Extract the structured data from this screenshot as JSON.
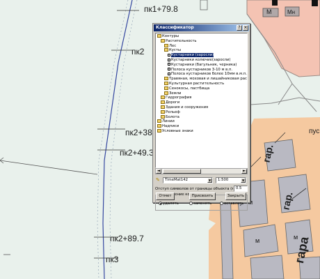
{
  "map": {
    "stations": [
      "пк1+79.8",
      "пк2",
      "пк2+38",
      "пк2+49.3",
      "пк2+89.7",
      "пк3"
    ],
    "building_labels": [
      "М",
      "Мн",
      "м",
      "м",
      "м"
    ],
    "street_labels": [
      "гар.",
      "гар.",
      "гара",
      "пус"
    ]
  },
  "dialog": {
    "title": "Классификатор",
    "tree": [
      {
        "label": "Контуры",
        "level": 0
      },
      {
        "label": "Растительность",
        "level": 1
      },
      {
        "label": "Лес",
        "level": 2
      },
      {
        "label": "Кусты",
        "level": 2
      },
      {
        "label": "Кустарники (заросли)",
        "level": 3,
        "selected": true
      },
      {
        "label": "Кустарники колючие(заросли)",
        "level": 3
      },
      {
        "label": "Кустарники (багульник, черника)",
        "level": 3
      },
      {
        "label": "Полоса кустарников 3-10 м в.п.",
        "level": 3
      },
      {
        "label": "Полоса кустарников более 10мм в.м.п.",
        "level": 3
      },
      {
        "label": "Травяная, моховая и лишайниковая растительн",
        "level": 2
      },
      {
        "label": "Культурная растительность",
        "level": 2
      },
      {
        "label": "Сенокосы, пастбища",
        "level": 2
      },
      {
        "label": "Земли",
        "level": 2
      },
      {
        "label": "Гидрография",
        "level": 1
      },
      {
        "label": "Дороги",
        "level": 1
      },
      {
        "label": "Здания и сооружения",
        "level": 1
      },
      {
        "label": "Рельеф",
        "level": 1
      },
      {
        "label": "Болота",
        "level": 1
      },
      {
        "label": "Линии",
        "level": 0
      },
      {
        "label": "Надписи",
        "level": 0
      },
      {
        "label": "Условные знаки",
        "level": 0
      }
    ],
    "font_value": "TimeMat142",
    "scale_value": "1:500",
    "offset_label": "Отступ символов от границы объекта (м):",
    "offset_value": "0.5",
    "fill_group_label": "Заполнение контуров",
    "radio_options": [
      "удалять",
      "заменять",
      "оставлять"
    ],
    "selected_radio": 0,
    "buttons": {
      "cancel": "Отмет",
      "assign": "Присвоить",
      "close": "Закрыть"
    }
  }
}
